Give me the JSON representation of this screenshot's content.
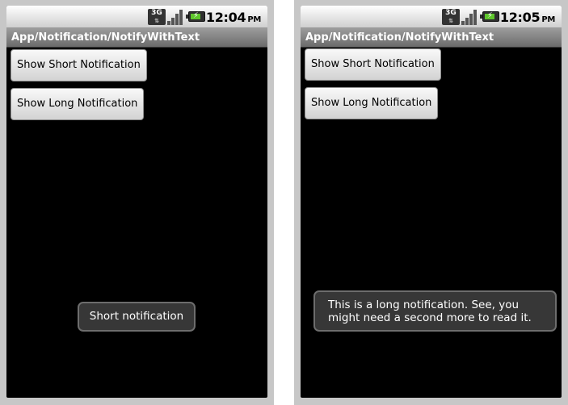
{
  "screens": [
    {
      "status": {
        "network_label": "3G",
        "time": "12:04",
        "ampm": "PM"
      },
      "title": "App/Notification/NotifyWithText",
      "buttons": {
        "short": "Show Short Notification",
        "long": "Show Long Notification"
      },
      "toast": "Short notification"
    },
    {
      "status": {
        "network_label": "3G",
        "time": "12:05",
        "ampm": "PM"
      },
      "title": "App/Notification/NotifyWithText",
      "buttons": {
        "short": "Show Short Notification",
        "long": "Show Long Notification"
      },
      "toast": "This is a long notification. See, you might need a second more to read it."
    }
  ],
  "icons": {
    "network": "3g-data-icon",
    "signal": "signal-strength-icon",
    "battery": "battery-charging-icon"
  },
  "colors": {
    "statusbar_top": "#ffffff",
    "statusbar_bottom": "#cfcfcf",
    "titlebar_top": "#9c9c9c",
    "titlebar_bottom": "#6b6b6b",
    "background": "#000000",
    "toast_bg": "#3a3a3a",
    "battery_fill": "#5ec62b"
  },
  "battery_level": 0.8
}
